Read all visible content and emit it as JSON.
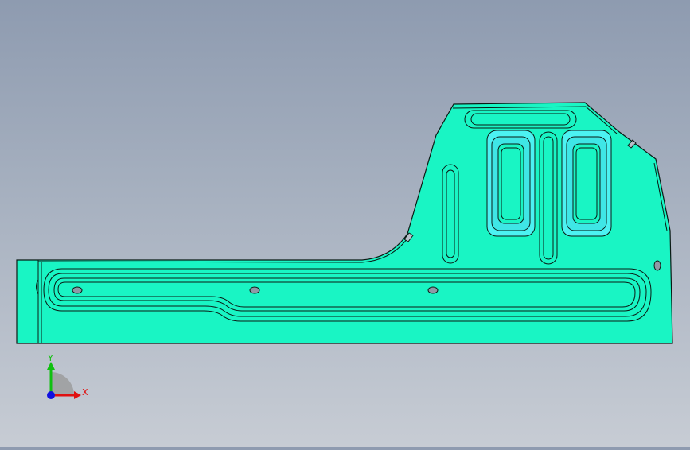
{
  "viewport": {
    "background_top": "#8e9bb0",
    "background_bottom": "#c7ccd4",
    "part_fill": "#19f5c4",
    "pocket_fill": "#4cf2f2",
    "edge_color": "#0a1a14"
  },
  "triad": {
    "x_label": "X",
    "y_label": "Y",
    "x_color": "#e01010",
    "y_color": "#10c010",
    "z_color": "#1010e0"
  }
}
